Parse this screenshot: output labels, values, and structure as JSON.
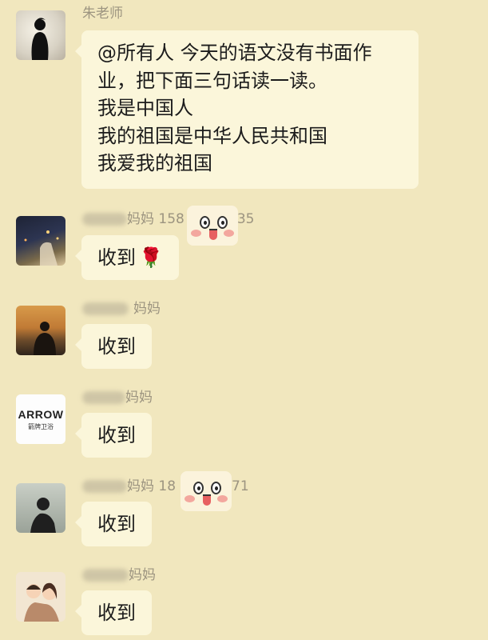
{
  "messages": [
    {
      "sender": "朱老师",
      "lines": [
        "@所有人 今天的语文没有书面作",
        "业，把下面三句话读一读。",
        "我是中国人",
        "我的祖国是中华人民共和国",
        "我爱我的祖国"
      ]
    },
    {
      "sender_visible": "妈妈 158",
      "sender_tail": "35",
      "text": "收到",
      "emoji": "🌹"
    },
    {
      "sender_visible": "妈妈",
      "text": "收到"
    },
    {
      "sender_visible": "妈妈",
      "text": "收到",
      "avatar_brand": "ARROW",
      "avatar_brand_sub": "箭牌卫浴"
    },
    {
      "sender_visible": "妈妈 18",
      "sender_tail": "71",
      "text": "收到"
    },
    {
      "sender_visible": "妈妈",
      "text": "收到"
    }
  ],
  "icons": {
    "redaction_sticker": "smiley-face-icon",
    "emoji": "rose-icon"
  },
  "colors": {
    "background": "#f1e7be",
    "bubble": "#fbf6da",
    "sender_text": "#9c9480"
  }
}
